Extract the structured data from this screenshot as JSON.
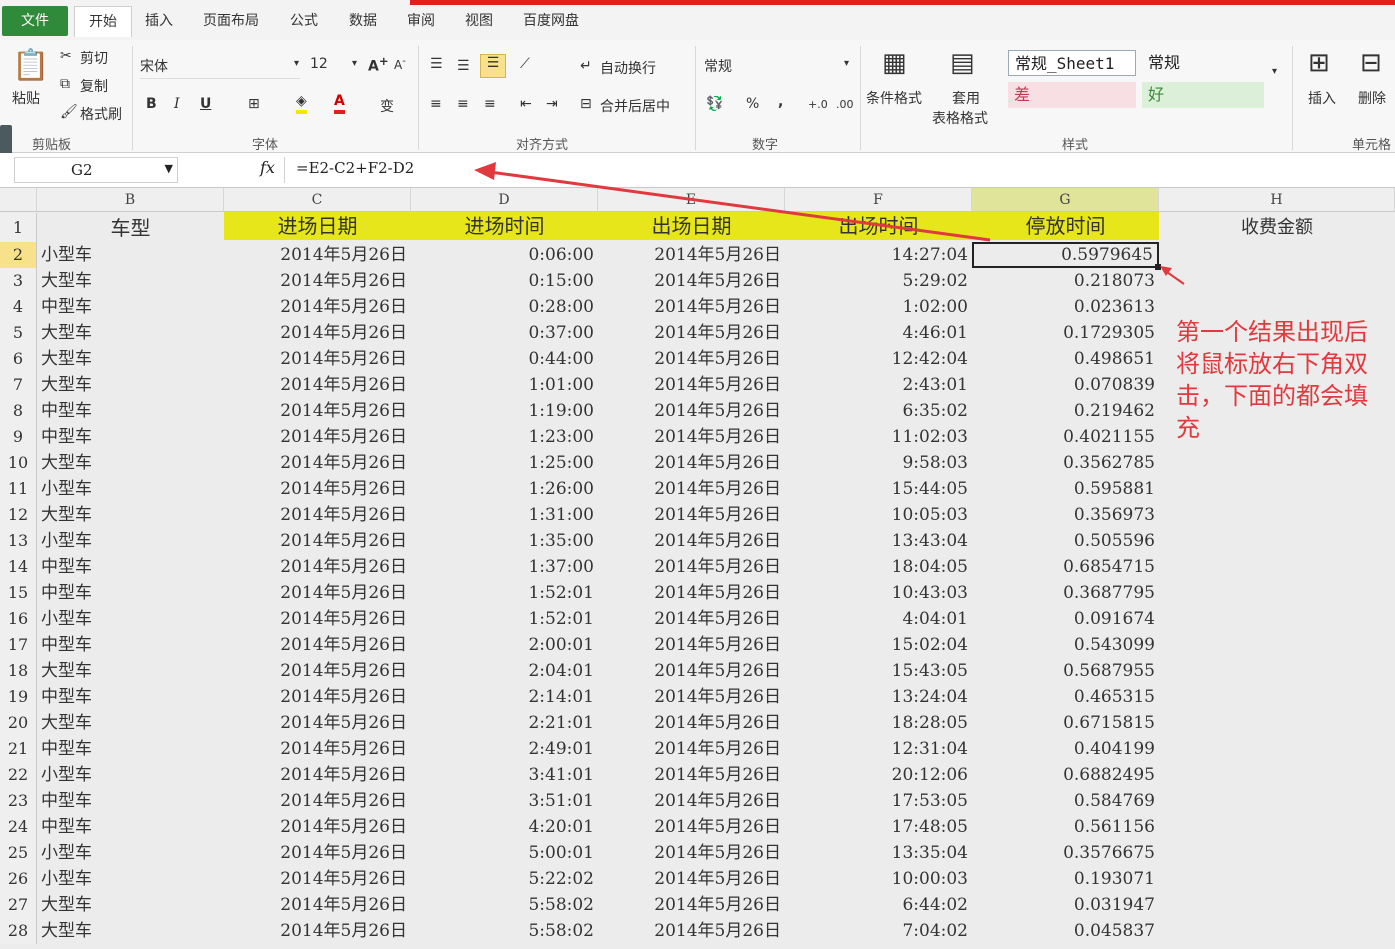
{
  "tabs": [
    "文件",
    "开始",
    "插入",
    "页面布局",
    "公式",
    "数据",
    "审阅",
    "视图",
    "百度网盘"
  ],
  "ribbon": {
    "paste": "粘贴",
    "cut": "剪切",
    "copy": "复制",
    "format_painter": "格式刷",
    "clipboard_group": "剪贴板",
    "font_name": "宋体",
    "font_size": "12",
    "font_group": "字体",
    "wrap_text": "自动换行",
    "merge_center": "合并后居中",
    "align_group": "对齐方式",
    "number_format": "常规",
    "percent": "%",
    "comma": ",",
    "number_group": "数字",
    "cond_format": "条件格式",
    "table_format_1": "套用",
    "table_format_2": "表格格式",
    "style_sheet1": "常规_Sheet1",
    "style_normal": "常规",
    "style_bad": "差",
    "style_good": "好",
    "style_group": "样式",
    "insert": "插入",
    "delete": "删除",
    "cells_group": "单元格",
    "bold": "B",
    "italic": "I",
    "underline": "U",
    "font_color_letter": "A"
  },
  "formula_bar": {
    "name_box": "G2",
    "fx": "fx",
    "formula": "=E2-C2+F2-D2"
  },
  "columns": [
    "B",
    "C",
    "D",
    "E",
    "F",
    "G",
    "H"
  ],
  "headers": {
    "B": "车型",
    "C": "进场日期",
    "D": "进场时间",
    "E": "出场日期",
    "F": "出场时间",
    "G": "停放时间",
    "H": "收费金额"
  },
  "rows": [
    {
      "n": "1"
    },
    {
      "n": "2",
      "type": "小型车",
      "c": "2014年5月26日",
      "d": "0:06:00",
      "e": "2014年5月26日",
      "f": "14:27:04",
      "g": "0.5979645"
    },
    {
      "n": "3",
      "type": "大型车",
      "c": "2014年5月26日",
      "d": "0:15:00",
      "e": "2014年5月26日",
      "f": "5:29:02",
      "g": "0.218073"
    },
    {
      "n": "4",
      "type": "中型车",
      "c": "2014年5月26日",
      "d": "0:28:00",
      "e": "2014年5月26日",
      "f": "1:02:00",
      "g": "0.023613"
    },
    {
      "n": "5",
      "type": "大型车",
      "c": "2014年5月26日",
      "d": "0:37:00",
      "e": "2014年5月26日",
      "f": "4:46:01",
      "g": "0.1729305"
    },
    {
      "n": "6",
      "type": "大型车",
      "c": "2014年5月26日",
      "d": "0:44:00",
      "e": "2014年5月26日",
      "f": "12:42:04",
      "g": "0.498651"
    },
    {
      "n": "7",
      "type": "大型车",
      "c": "2014年5月26日",
      "d": "1:01:00",
      "e": "2014年5月26日",
      "f": "2:43:01",
      "g": "0.070839"
    },
    {
      "n": "8",
      "type": "中型车",
      "c": "2014年5月26日",
      "d": "1:19:00",
      "e": "2014年5月26日",
      "f": "6:35:02",
      "g": "0.219462"
    },
    {
      "n": "9",
      "type": "中型车",
      "c": "2014年5月26日",
      "d": "1:23:00",
      "e": "2014年5月26日",
      "f": "11:02:03",
      "g": "0.4021155"
    },
    {
      "n": "10",
      "type": "大型车",
      "c": "2014年5月26日",
      "d": "1:25:00",
      "e": "2014年5月26日",
      "f": "9:58:03",
      "g": "0.3562785"
    },
    {
      "n": "11",
      "type": "小型车",
      "c": "2014年5月26日",
      "d": "1:26:00",
      "e": "2014年5月26日",
      "f": "15:44:05",
      "g": "0.595881"
    },
    {
      "n": "12",
      "type": "大型车",
      "c": "2014年5月26日",
      "d": "1:31:00",
      "e": "2014年5月26日",
      "f": "10:05:03",
      "g": "0.356973"
    },
    {
      "n": "13",
      "type": "小型车",
      "c": "2014年5月26日",
      "d": "1:35:00",
      "e": "2014年5月26日",
      "f": "13:43:04",
      "g": "0.505596"
    },
    {
      "n": "14",
      "type": "中型车",
      "c": "2014年5月26日",
      "d": "1:37:00",
      "e": "2014年5月26日",
      "f": "18:04:05",
      "g": "0.6854715"
    },
    {
      "n": "15",
      "type": "中型车",
      "c": "2014年5月26日",
      "d": "1:52:01",
      "e": "2014年5月26日",
      "f": "10:43:03",
      "g": "0.3687795"
    },
    {
      "n": "16",
      "type": "小型车",
      "c": "2014年5月26日",
      "d": "1:52:01",
      "e": "2014年5月26日",
      "f": "4:04:01",
      "g": "0.091674"
    },
    {
      "n": "17",
      "type": "中型车",
      "c": "2014年5月26日",
      "d": "2:00:01",
      "e": "2014年5月26日",
      "f": "15:02:04",
      "g": "0.543099"
    },
    {
      "n": "18",
      "type": "大型车",
      "c": "2014年5月26日",
      "d": "2:04:01",
      "e": "2014年5月26日",
      "f": "15:43:05",
      "g": "0.5687955"
    },
    {
      "n": "19",
      "type": "中型车",
      "c": "2014年5月26日",
      "d": "2:14:01",
      "e": "2014年5月26日",
      "f": "13:24:04",
      "g": "0.465315"
    },
    {
      "n": "20",
      "type": "大型车",
      "c": "2014年5月26日",
      "d": "2:21:01",
      "e": "2014年5月26日",
      "f": "18:28:05",
      "g": "0.6715815"
    },
    {
      "n": "21",
      "type": "中型车",
      "c": "2014年5月26日",
      "d": "2:49:01",
      "e": "2014年5月26日",
      "f": "12:31:04",
      "g": "0.404199"
    },
    {
      "n": "22",
      "type": "小型车",
      "c": "2014年5月26日",
      "d": "3:41:01",
      "e": "2014年5月26日",
      "f": "20:12:06",
      "g": "0.6882495"
    },
    {
      "n": "23",
      "type": "中型车",
      "c": "2014年5月26日",
      "d": "3:51:01",
      "e": "2014年5月26日",
      "f": "17:53:05",
      "g": "0.584769"
    },
    {
      "n": "24",
      "type": "中型车",
      "c": "2014年5月26日",
      "d": "4:20:01",
      "e": "2014年5月26日",
      "f": "17:48:05",
      "g": "0.561156"
    },
    {
      "n": "25",
      "type": "小型车",
      "c": "2014年5月26日",
      "d": "5:00:01",
      "e": "2014年5月26日",
      "f": "13:35:04",
      "g": "0.3576675"
    },
    {
      "n": "26",
      "type": "小型车",
      "c": "2014年5月26日",
      "d": "5:22:02",
      "e": "2014年5月26日",
      "f": "10:00:03",
      "g": "0.193071"
    },
    {
      "n": "27",
      "type": "大型车",
      "c": "2014年5月26日",
      "d": "5:58:02",
      "e": "2014年5月26日",
      "f": "6:44:02",
      "g": "0.031947"
    },
    {
      "n": "28",
      "type": "大型车",
      "c": "2014年5月26日",
      "d": "5:58:02",
      "e": "2014年5月26日",
      "f": "7:04:02",
      "g": "0.045837"
    }
  ],
  "annotation": "第一个结果出现后将鼠标放右下角双击，下面的都会填充",
  "colors": {
    "header_fill": "#e6e61a",
    "arrow": "#e0393e",
    "file_tab": "#2f8a3a"
  }
}
